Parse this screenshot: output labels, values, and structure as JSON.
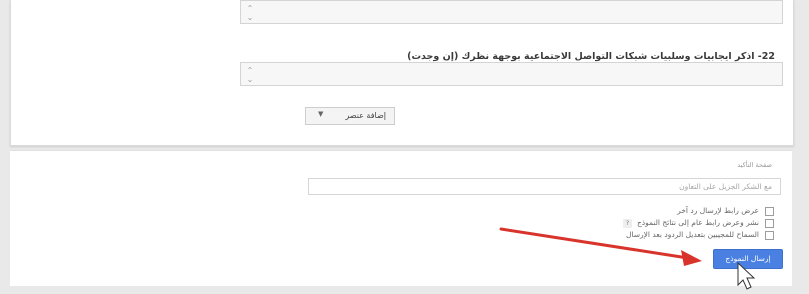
{
  "question": {
    "title": "22- اذكر ايجابيات وسلبيات شبكات التواصل الاجتماعية بوجهة نظرك (إن وجدت)"
  },
  "add_item": {
    "label": "إضافة عنصر",
    "caret": "▼"
  },
  "confirmation": {
    "title": "صفحة التأكيد",
    "message_placeholder": "مع الشكر الجزيل على التعاون",
    "options": [
      {
        "label": "عرض رابط لإرسال رد آخر",
        "checked": false,
        "help": ""
      },
      {
        "label": "نشر وعرض رابط عام إلى نتائج النموذج",
        "checked": false,
        "help": "?"
      },
      {
        "label": "السماح للمجيبين بتعديل الردود بعد الإرسال",
        "checked": false,
        "help": ""
      }
    ],
    "submit_label": "إرسال النموذج"
  },
  "colors": {
    "accent": "#4a80e1",
    "arrow": "#d9342b"
  },
  "icons": {
    "resize": "resize-handle-icon",
    "cursor": "mouse-cursor-icon",
    "arrow": "red-arrow-annotation"
  }
}
